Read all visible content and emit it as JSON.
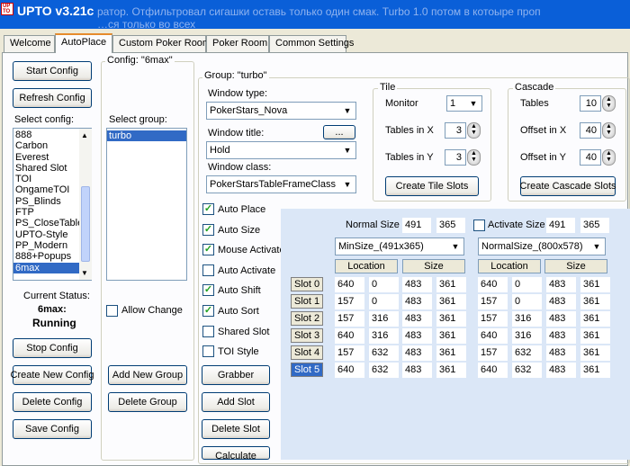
{
  "window": {
    "title": "UPTO  v3.21c",
    "logo_top": "UP",
    "logo_bottom": "TO",
    "bg_text_line1": "ратор. Отфильтровал сигашки оставь только один смак. Turbo 1.0 потом в котоыре проп",
    "bg_text_line2": "…ся только во всех"
  },
  "tabs": [
    "Welcome",
    "AutoPlace",
    "Custom Poker Room",
    "Poker Room",
    "Common Settings"
  ],
  "active_tab": "AutoPlace",
  "left": {
    "start_config": "Start Config",
    "refresh_config": "Refresh Config",
    "select_config_label": "Select config:",
    "configs": [
      "888",
      "Carbon",
      "Everest",
      "Shared Slot",
      "TOI",
      "OngameTOI",
      "PS_Blinds",
      "FTP",
      "PS_CloseTable",
      "UPTO-Style",
      "PP_Modern",
      "888+Popups",
      "6max"
    ],
    "selected_config": "6max",
    "status_label": "Current Status:",
    "status_config": "6max:",
    "status_state": "Running",
    "stop_config": "Stop Config",
    "create_config": "Create New Config",
    "delete_config": "Delete Config",
    "save_config": "Save Config"
  },
  "config_group": {
    "title": "Config: \"6max\"",
    "select_group_label": "Select group:",
    "groups": [
      "turbo"
    ],
    "allow_change": "Allow Change",
    "add_group": "Add New Group",
    "delete_group": "Delete Group"
  },
  "group": {
    "title": "Group: \"turbo\"",
    "window_type_label": "Window type:",
    "window_type": "PokerStars_Nova",
    "window_title_label": "Window title:",
    "browse": "...",
    "window_title": "Hold",
    "window_class_label": "Window class:",
    "window_class": "PokerStarsTableFrameClass",
    "options": [
      {
        "label": "Auto Place",
        "checked": true
      },
      {
        "label": "Auto Size",
        "checked": true
      },
      {
        "label": "Mouse Activate",
        "checked": true
      },
      {
        "label": "Auto Activate",
        "checked": false
      },
      {
        "label": "Auto Shift",
        "checked": true
      },
      {
        "label": "Auto Sort",
        "checked": true
      },
      {
        "label": "Shared Slot",
        "checked": false
      },
      {
        "label": "TOI Style",
        "checked": false
      }
    ],
    "grabber": "Grabber",
    "add_slot": "Add Slot",
    "delete_slot": "Delete Slot",
    "calculate": "Calculate"
  },
  "tile": {
    "title": "Tile",
    "monitor_label": "Monitor",
    "monitor": "1",
    "tables_x_label": "Tables in X",
    "tables_x": "3",
    "tables_y_label": "Tables in Y",
    "tables_y": "3",
    "create": "Create Tile Slots"
  },
  "cascade": {
    "title": "Cascade",
    "tables_label": "Tables",
    "tables": "10",
    "offset_x_label": "Offset in X",
    "offset_x": "40",
    "offset_y_label": "Offset in Y",
    "offset_y": "40",
    "create": "Create Cascade Slots"
  },
  "slots": {
    "normal_size_label": "Normal Size",
    "normal_w": "491",
    "normal_h": "365",
    "activate_size_label": "Activate Size",
    "activate_checked": false,
    "activate_w": "491",
    "activate_h": "365",
    "min_size_combo": "MinSize_(491x365)",
    "normal_size_combo": "NormalSize_(800x578)",
    "location_header": "Location",
    "size_header": "Size",
    "selected_slot": "Slot 5",
    "rows": [
      {
        "label": "Slot 0",
        "a": [
          "640",
          "0",
          "483",
          "361"
        ],
        "b": [
          "640",
          "0",
          "483",
          "361"
        ]
      },
      {
        "label": "Slot 1",
        "a": [
          "157",
          "0",
          "483",
          "361"
        ],
        "b": [
          "157",
          "0",
          "483",
          "361"
        ]
      },
      {
        "label": "Slot 2",
        "a": [
          "157",
          "316",
          "483",
          "361"
        ],
        "b": [
          "157",
          "316",
          "483",
          "361"
        ]
      },
      {
        "label": "Slot 3",
        "a": [
          "640",
          "316",
          "483",
          "361"
        ],
        "b": [
          "640",
          "316",
          "483",
          "361"
        ]
      },
      {
        "label": "Slot 4",
        "a": [
          "157",
          "632",
          "483",
          "361"
        ],
        "b": [
          "157",
          "632",
          "483",
          "361"
        ]
      },
      {
        "label": "Slot 5",
        "a": [
          "640",
          "632",
          "483",
          "361"
        ],
        "b": [
          "640",
          "632",
          "483",
          "361"
        ]
      }
    ]
  }
}
